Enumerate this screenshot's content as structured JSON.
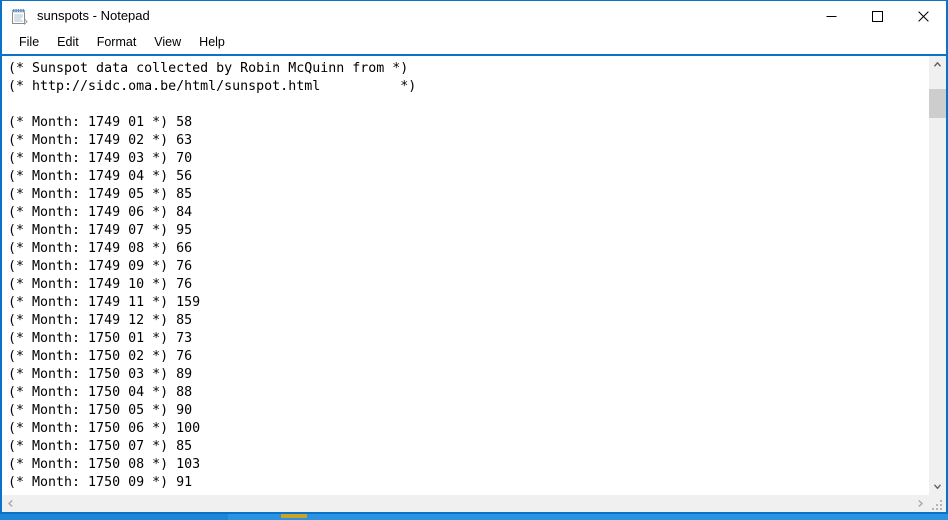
{
  "window": {
    "title": "sunspots - Notepad",
    "icon": "notepad-icon",
    "accent_color": "#0a72c8",
    "controls": {
      "minimize_label": "Minimize",
      "maximize_label": "Maximize",
      "close_label": "Close"
    }
  },
  "menubar": {
    "items": [
      {
        "label": "File"
      },
      {
        "label": "Edit"
      },
      {
        "label": "Format"
      },
      {
        "label": "View"
      },
      {
        "label": "Help"
      }
    ]
  },
  "document": {
    "header_lines": [
      "(* Sunspot data collected by Robin McQuinn from *)",
      "(* http://sidc.oma.be/html/sunspot.html          *)"
    ],
    "blank_line": "",
    "records": [
      {
        "line": "(* Month: 1749 01 *) 58",
        "year": "1749",
        "month": "01",
        "value": "58"
      },
      {
        "line": "(* Month: 1749 02 *) 63",
        "year": "1749",
        "month": "02",
        "value": "63"
      },
      {
        "line": "(* Month: 1749 03 *) 70",
        "year": "1749",
        "month": "03",
        "value": "70"
      },
      {
        "line": "(* Month: 1749 04 *) 56",
        "year": "1749",
        "month": "04",
        "value": "56"
      },
      {
        "line": "(* Month: 1749 05 *) 85",
        "year": "1749",
        "month": "05",
        "value": "85"
      },
      {
        "line": "(* Month: 1749 06 *) 84",
        "year": "1749",
        "month": "06",
        "value": "84"
      },
      {
        "line": "(* Month: 1749 07 *) 95",
        "year": "1749",
        "month": "07",
        "value": "95"
      },
      {
        "line": "(* Month: 1749 08 *) 66",
        "year": "1749",
        "month": "08",
        "value": "66"
      },
      {
        "line": "(* Month: 1749 09 *) 76",
        "year": "1749",
        "month": "09",
        "value": "76"
      },
      {
        "line": "(* Month: 1749 10 *) 76",
        "year": "1749",
        "month": "10",
        "value": "76"
      },
      {
        "line": "(* Month: 1749 11 *) 159",
        "year": "1749",
        "month": "11",
        "value": "159"
      },
      {
        "line": "(* Month: 1749 12 *) 85",
        "year": "1749",
        "month": "12",
        "value": "85"
      },
      {
        "line": "(* Month: 1750 01 *) 73",
        "year": "1750",
        "month": "01",
        "value": "73"
      },
      {
        "line": "(* Month: 1750 02 *) 76",
        "year": "1750",
        "month": "02",
        "value": "76"
      },
      {
        "line": "(* Month: 1750 03 *) 89",
        "year": "1750",
        "month": "03",
        "value": "89"
      },
      {
        "line": "(* Month: 1750 04 *) 88",
        "year": "1750",
        "month": "04",
        "value": "88"
      },
      {
        "line": "(* Month: 1750 05 *) 90",
        "year": "1750",
        "month": "05",
        "value": "90"
      },
      {
        "line": "(* Month: 1750 06 *) 100",
        "year": "1750",
        "month": "06",
        "value": "100"
      },
      {
        "line": "(* Month: 1750 07 *) 85",
        "year": "1750",
        "month": "07",
        "value": "85"
      },
      {
        "line": "(* Month: 1750 08 *) 103",
        "year": "1750",
        "month": "08",
        "value": "103"
      },
      {
        "line": "(* Month: 1750 09 *) 91",
        "year": "1750",
        "month": "09",
        "value": "91"
      }
    ],
    "full_text": "(* Sunspot data collected by Robin McQuinn from *)\n(* http://sidc.oma.be/html/sunspot.html          *)\n\n(* Month: 1749 01 *) 58\n(* Month: 1749 02 *) 63\n(* Month: 1749 03 *) 70\n(* Month: 1749 04 *) 56\n(* Month: 1749 05 *) 85\n(* Month: 1749 06 *) 84\n(* Month: 1749 07 *) 95\n(* Month: 1749 08 *) 66\n(* Month: 1749 09 *) 76\n(* Month: 1749 10 *) 76\n(* Month: 1749 11 *) 159\n(* Month: 1749 12 *) 85\n(* Month: 1750 01 *) 73\n(* Month: 1750 02 *) 76\n(* Month: 1750 03 *) 89\n(* Month: 1750 04 *) 88\n(* Month: 1750 05 *) 90\n(* Month: 1750 06 *) 100\n(* Month: 1750 07 *) 85\n(* Month: 1750 08 *) 103\n(* Month: 1750 09 *) 91"
  },
  "scrollbars": {
    "vertical": {
      "up_arrow": "chevron-up-icon",
      "down_arrow": "chevron-down-icon",
      "thumb_top_pct": 4,
      "thumb_height_pct": 7
    },
    "horizontal": {
      "left_arrow": "chevron-left-icon",
      "right_arrow": "chevron-right-icon"
    },
    "resize_grip": "resize-grip-icon"
  }
}
